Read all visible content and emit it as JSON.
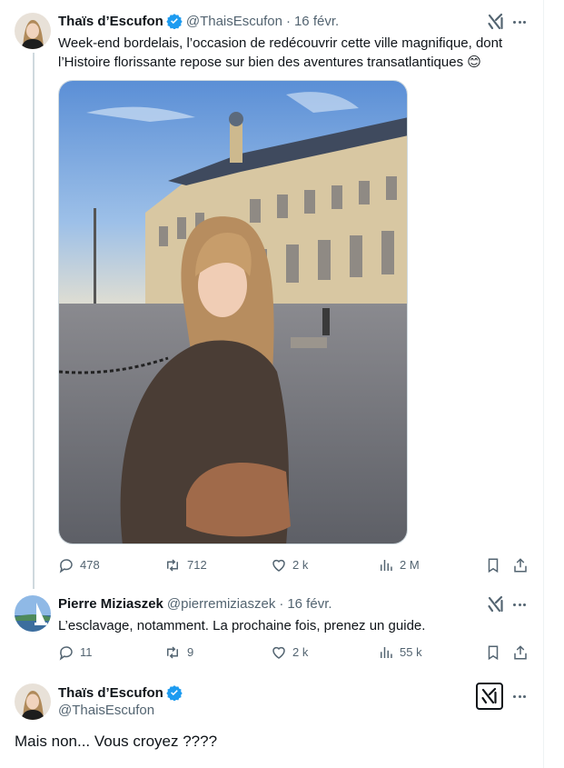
{
  "tweet1": {
    "author_name": "Thaïs d’Escufon",
    "author_handle": "@ThaisEscufon",
    "separator": "·",
    "date": "16 févr.",
    "text_line1": "Week-end bordelais, l’occasion de redécouvrir cette ville magnifique, dont",
    "text_line2": "l’Histoire florissante repose sur bien des aventures transatlantiques 😊",
    "stats": {
      "replies": "478",
      "reposts": "712",
      "likes": "2 k",
      "views": "2 M"
    }
  },
  "reply": {
    "author_name": "Pierre Miziaszek",
    "author_handle": "@pierremiziaszek",
    "separator": "·",
    "date": "16 févr.",
    "text": "L’esclavage, notamment. La prochaine fois, prenez un guide.",
    "stats": {
      "replies": "11",
      "reposts": "9",
      "likes": "2 k",
      "views": "55 k"
    }
  },
  "tweet3": {
    "author_name": "Thaïs d’Escufon",
    "author_handle": "@ThaisEscufon",
    "text": "Mais non... Vous croyez ????"
  },
  "icons": {
    "verified": "verified-badge-icon",
    "grok": "grok-icon",
    "more": "more-icon",
    "reply": "reply-icon",
    "repost": "repost-icon",
    "like": "like-icon",
    "views": "views-icon",
    "bookmark": "bookmark-icon",
    "share": "share-icon"
  },
  "colors": {
    "text": "#0f1419",
    "muted": "#536471",
    "verified": "#1d9bf0",
    "border": "#cfd9de"
  }
}
